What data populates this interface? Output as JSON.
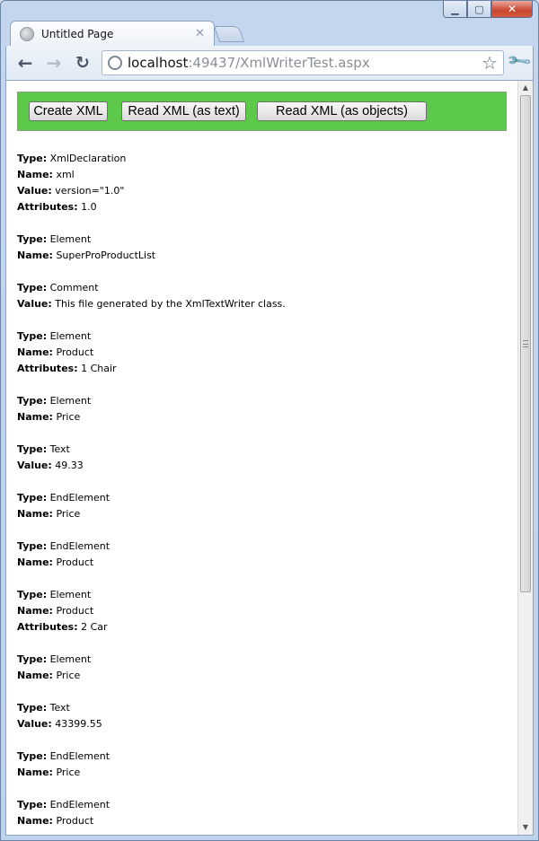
{
  "browser": {
    "tab_title": "Untitled Page",
    "url_host": "localhost",
    "url_rest": ":49437/XmlWriterTest.aspx",
    "window_controls": [
      "minimize-icon",
      "maximize-icon",
      "close-icon"
    ]
  },
  "toolbar": {
    "create_label": "Create XML",
    "read_text_label": "Read XML (as text)",
    "read_objects_label": "Read XML (as objects)",
    "accent": "#5cc94a"
  },
  "labels": {
    "type": "Type:",
    "name": "Name:",
    "value": "Value:",
    "attributes": "Attributes:"
  },
  "entries": [
    {
      "type": "XmlDeclaration",
      "name": "xml",
      "value": "version=\"1.0\"",
      "attributes": "1.0"
    },
    {
      "type": "Element",
      "name": "SuperProProductList"
    },
    {
      "type": "Comment",
      "value": "This file generated by the XmlTextWriter class."
    },
    {
      "type": "Element",
      "name": "Product",
      "attributes": "1 Chair"
    },
    {
      "type": "Element",
      "name": "Price"
    },
    {
      "type": "Text",
      "value": "49.33"
    },
    {
      "type": "EndElement",
      "name": "Price"
    },
    {
      "type": "EndElement",
      "name": "Product"
    },
    {
      "type": "Element",
      "name": "Product",
      "attributes": "2 Car"
    },
    {
      "type": "Element",
      "name": "Price"
    },
    {
      "type": "Text",
      "value": "43399.55"
    },
    {
      "type": "EndElement",
      "name": "Price"
    },
    {
      "type": "EndElement",
      "name": "Product"
    }
  ]
}
